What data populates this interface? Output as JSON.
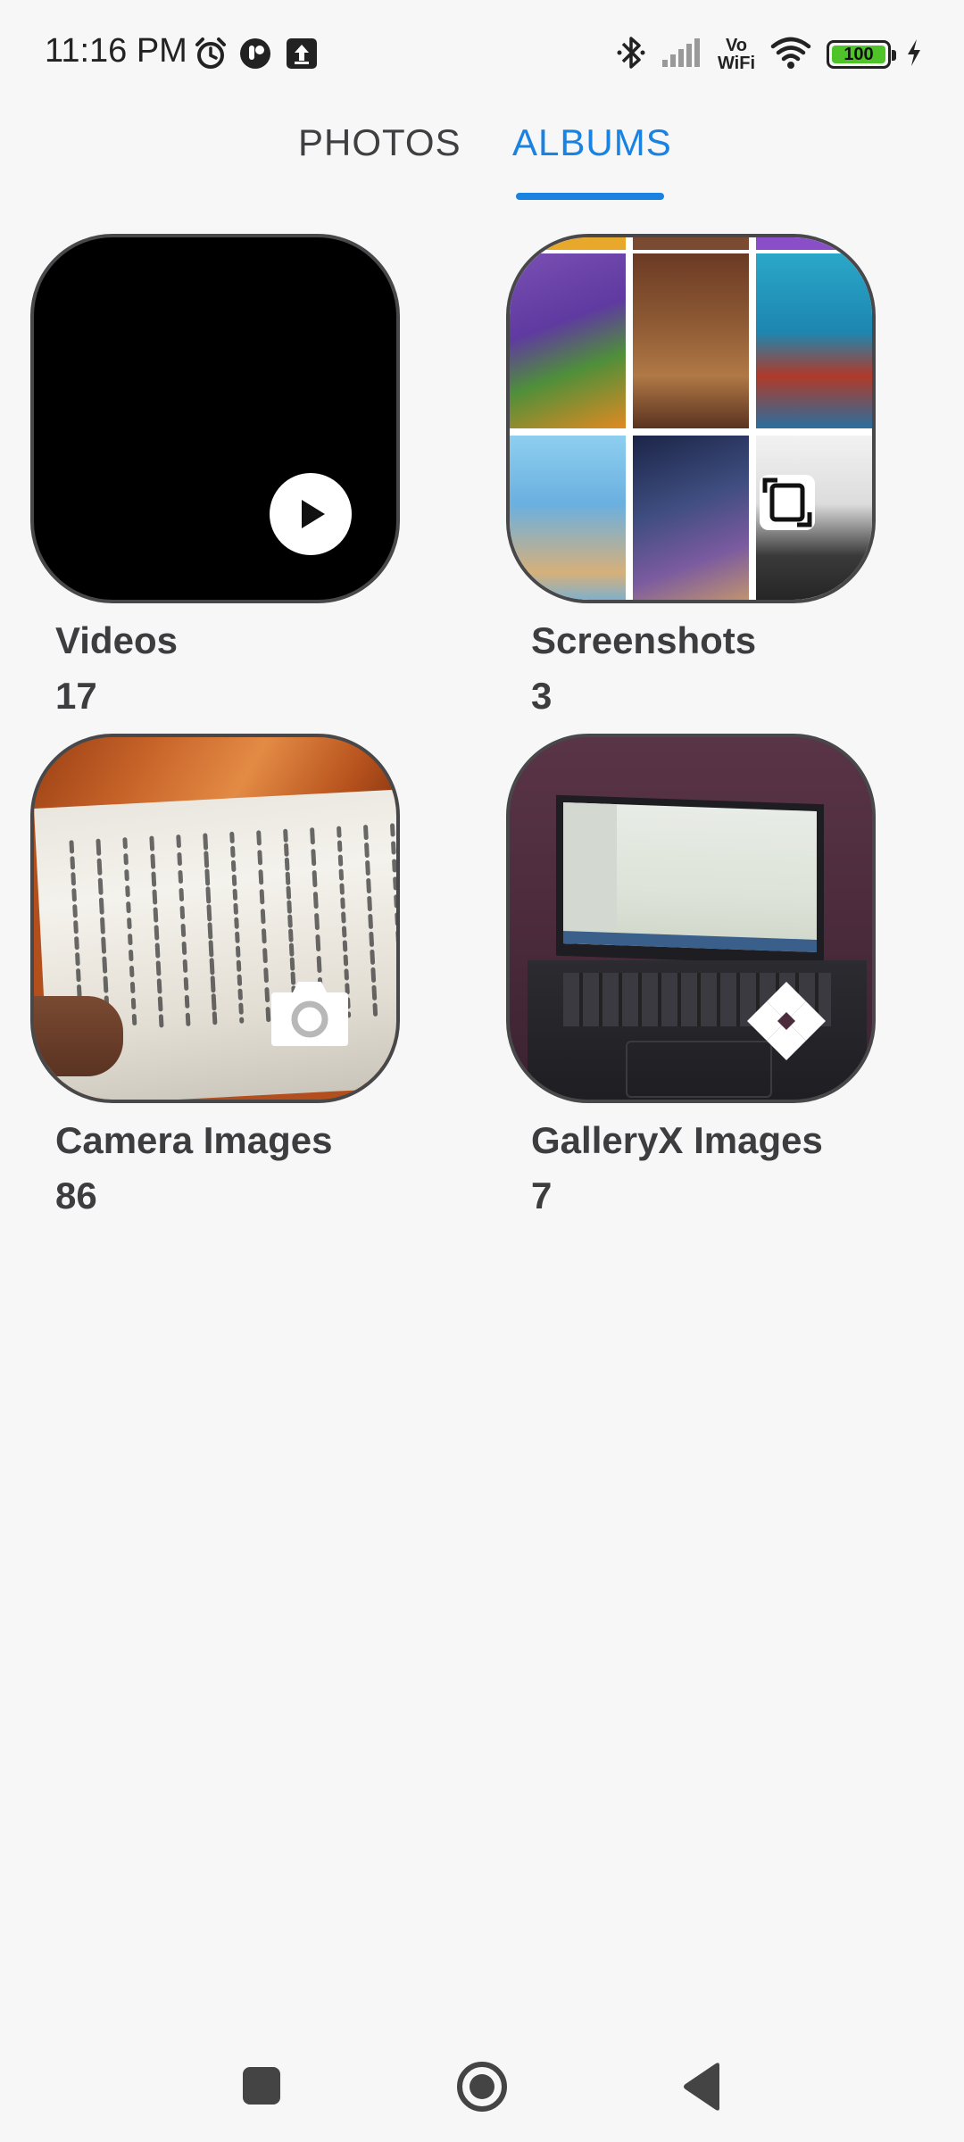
{
  "status_bar": {
    "time": "11:16 PM",
    "icons_left": [
      "alarm-icon",
      "app-notification-icon",
      "upload-icon"
    ],
    "icons_right": [
      "bluetooth-icon",
      "signal-icon",
      "volte-icon",
      "wifi-icon",
      "battery-icon",
      "charging-icon"
    ],
    "volte_line1": "Vo",
    "volte_line2": "WiFi",
    "battery_level": "100",
    "battery_color": "#4ec428"
  },
  "tabs": {
    "photos_label": "PHOTOS",
    "albums_label": "ALBUMS",
    "active": "ALBUMS",
    "accent_color": "#1a82e0"
  },
  "albums": [
    {
      "name": "Videos",
      "count": "17",
      "overlay_icon": "play-icon"
    },
    {
      "name": "Screenshots",
      "count": "3",
      "overlay_icon": "screenshot-icon"
    },
    {
      "name": "Camera Images",
      "count": "86",
      "overlay_icon": "camera-icon"
    },
    {
      "name": "GalleryX Images",
      "count": "7",
      "overlay_icon": "galleryx-logo-icon"
    }
  ],
  "nav_bar": {
    "buttons": [
      "recents-button",
      "home-button",
      "back-button"
    ]
  }
}
